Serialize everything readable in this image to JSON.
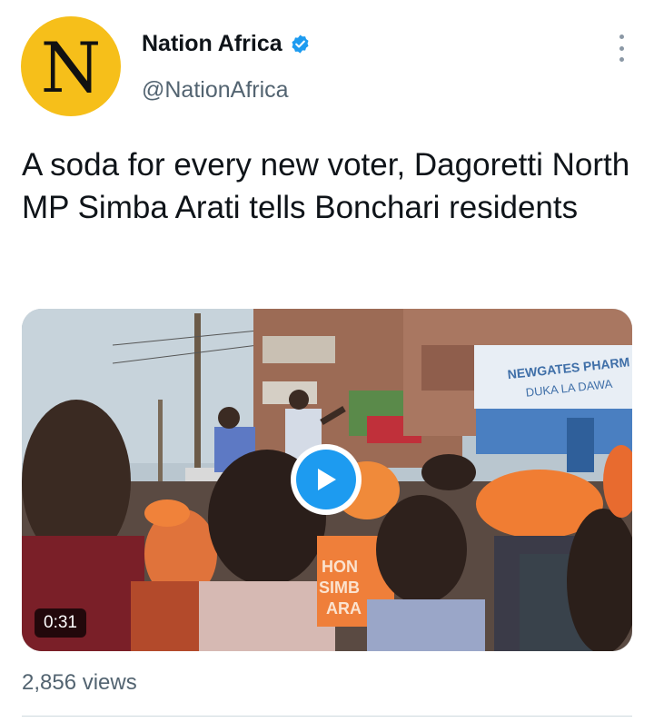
{
  "tweet": {
    "avatar_letter": "N",
    "author_name": "Nation Africa",
    "author_handle": "@NationAfrica",
    "verified": true,
    "text": "A soda for every new voter, Dagoretti North MP Simba Arati tells Bonchari residents",
    "video": {
      "duration": "0:31",
      "sign_line1": "NEWGATES PHARM",
      "sign_line2": "DUKA LA DAWA",
      "shirt_text1": "HON",
      "shirt_text2": "SIMB",
      "shirt_text3": "ARA"
    },
    "views": "2,856 views"
  },
  "colors": {
    "avatar_bg": "#f6bf1a",
    "verified_blue": "#1d9bf0",
    "secondary_text": "#536471",
    "play_blue": "#1d9bf0"
  },
  "icons": {
    "verified": "verified-badge-icon",
    "more": "more-vertical-icon",
    "play": "play-icon"
  }
}
